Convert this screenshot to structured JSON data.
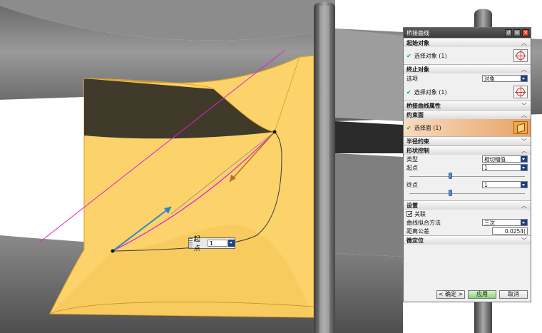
{
  "dialog": {
    "title": "桥接曲线",
    "title_buttons": [
      "reset-icon",
      "gear-icon",
      "close-icon"
    ],
    "start_object": {
      "header": "起始对象",
      "select_label": "选择对象 (1)"
    },
    "end_object": {
      "header": "终止对象",
      "option_label": "选项",
      "option_value": "对象",
      "select_label": "选择对象 (1)"
    },
    "bridge_props": {
      "header": "桥接曲线属性"
    },
    "constraint_face": {
      "header": "约束面",
      "select_label": "选择面 (1)"
    },
    "radius_constraint": {
      "header": "半径约束"
    },
    "shape_control": {
      "header": "形状控制",
      "type_label": "类型",
      "type_value": "相切幅值",
      "start_label": "起点",
      "start_value": "1",
      "start_slider": 0.35,
      "end_label": "终点",
      "end_value": "1",
      "end_slider": 0.35
    },
    "settings": {
      "header": "设置",
      "associative_label": "关联",
      "associative_checked": true,
      "fit_label": "曲线拟合方法",
      "fit_value": "三次",
      "tolerance_label": "距离公差",
      "tolerance_value": "0.0254("
    },
    "fine_position": {
      "header": "微定位"
    },
    "buttons": {
      "ok": "确定",
      "apply": "应用",
      "cancel": "取消"
    }
  },
  "floating_input": {
    "label": "起点",
    "value": "1"
  },
  "colors": {
    "face_highlight": "#fcd36a",
    "curve_magenta": "#e11fd5",
    "vector_blue": "#2a86c8",
    "apply_green": "#8bd47a"
  }
}
